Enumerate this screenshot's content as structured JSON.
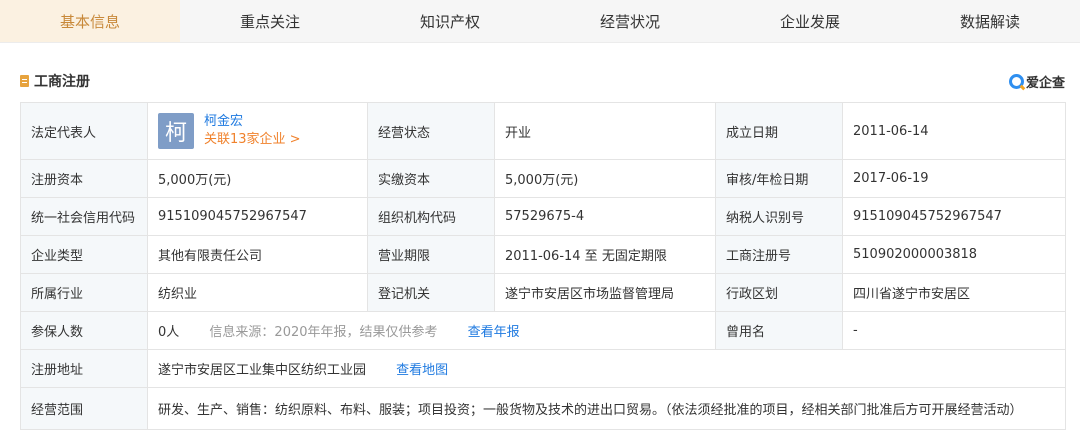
{
  "tabs": [
    {
      "label": "基本信息"
    },
    {
      "label": "重点关注"
    },
    {
      "label": "知识产权"
    },
    {
      "label": "经营状况"
    },
    {
      "label": "企业发展"
    },
    {
      "label": "数据解读"
    }
  ],
  "active_tab": "基本信息",
  "section": {
    "title": "工商注册",
    "brand": "爱企查"
  },
  "colors": {
    "accent": "#c8893a",
    "link": "#1f7ae0",
    "orange_link": "#f0822c",
    "label_bg": "#f5f8fa",
    "avatar_bg": "#7f9dc7"
  },
  "table": {
    "legal_rep": {
      "label": "法定代表人",
      "avatar_char": "柯",
      "name": "柯金宏",
      "related": "关联13家企业 >"
    },
    "op_status": {
      "label": "经营状态",
      "value": "开业"
    },
    "est_date": {
      "label": "成立日期",
      "value": "2011-06-14"
    },
    "reg_capital": {
      "label": "注册资本",
      "value": "5,000万(元)"
    },
    "paid_capital": {
      "label": "实缴资本",
      "value": "5,000万(元)"
    },
    "audit_date": {
      "label": "审核/年检日期",
      "value": "2017-06-19"
    },
    "credit_code": {
      "label": "统一社会信用代码",
      "value": "915109045752967547"
    },
    "org_code": {
      "label": "组织机构代码",
      "value": "57529675-4"
    },
    "taxpayer_id": {
      "label": "纳税人识别号",
      "value": "915109045752967547"
    },
    "company_type": {
      "label": "企业类型",
      "value": "其他有限责任公司"
    },
    "biz_term": {
      "label": "营业期限",
      "value": "2011-06-14 至 无固定期限"
    },
    "reg_no": {
      "label": "工商注册号",
      "value": "510902000003818"
    },
    "industry": {
      "label": "所属行业",
      "value": "纺织业"
    },
    "reg_authority": {
      "label": "登记机关",
      "value": "遂宁市安居区市场监督管理局"
    },
    "region": {
      "label": "行政区划",
      "value": "四川省遂宁市安居区"
    },
    "insured": {
      "label": "参保人数",
      "value": "0人",
      "source": "信息来源：2020年年报，结果仅供参考",
      "link": "查看年报"
    },
    "former_name": {
      "label": "曾用名",
      "value": "-"
    },
    "address": {
      "label": "注册地址",
      "value": "遂宁市安居区工业集中区纺织工业园",
      "link": "查看地图"
    },
    "scope": {
      "label": "经营范围",
      "value": "研发、生产、销售：纺织原料、布料、服装；项目投资；一般货物及技术的进出口贸易。（依法须经批准的项目，经相关部门批准后方可开展经营活动）"
    }
  }
}
